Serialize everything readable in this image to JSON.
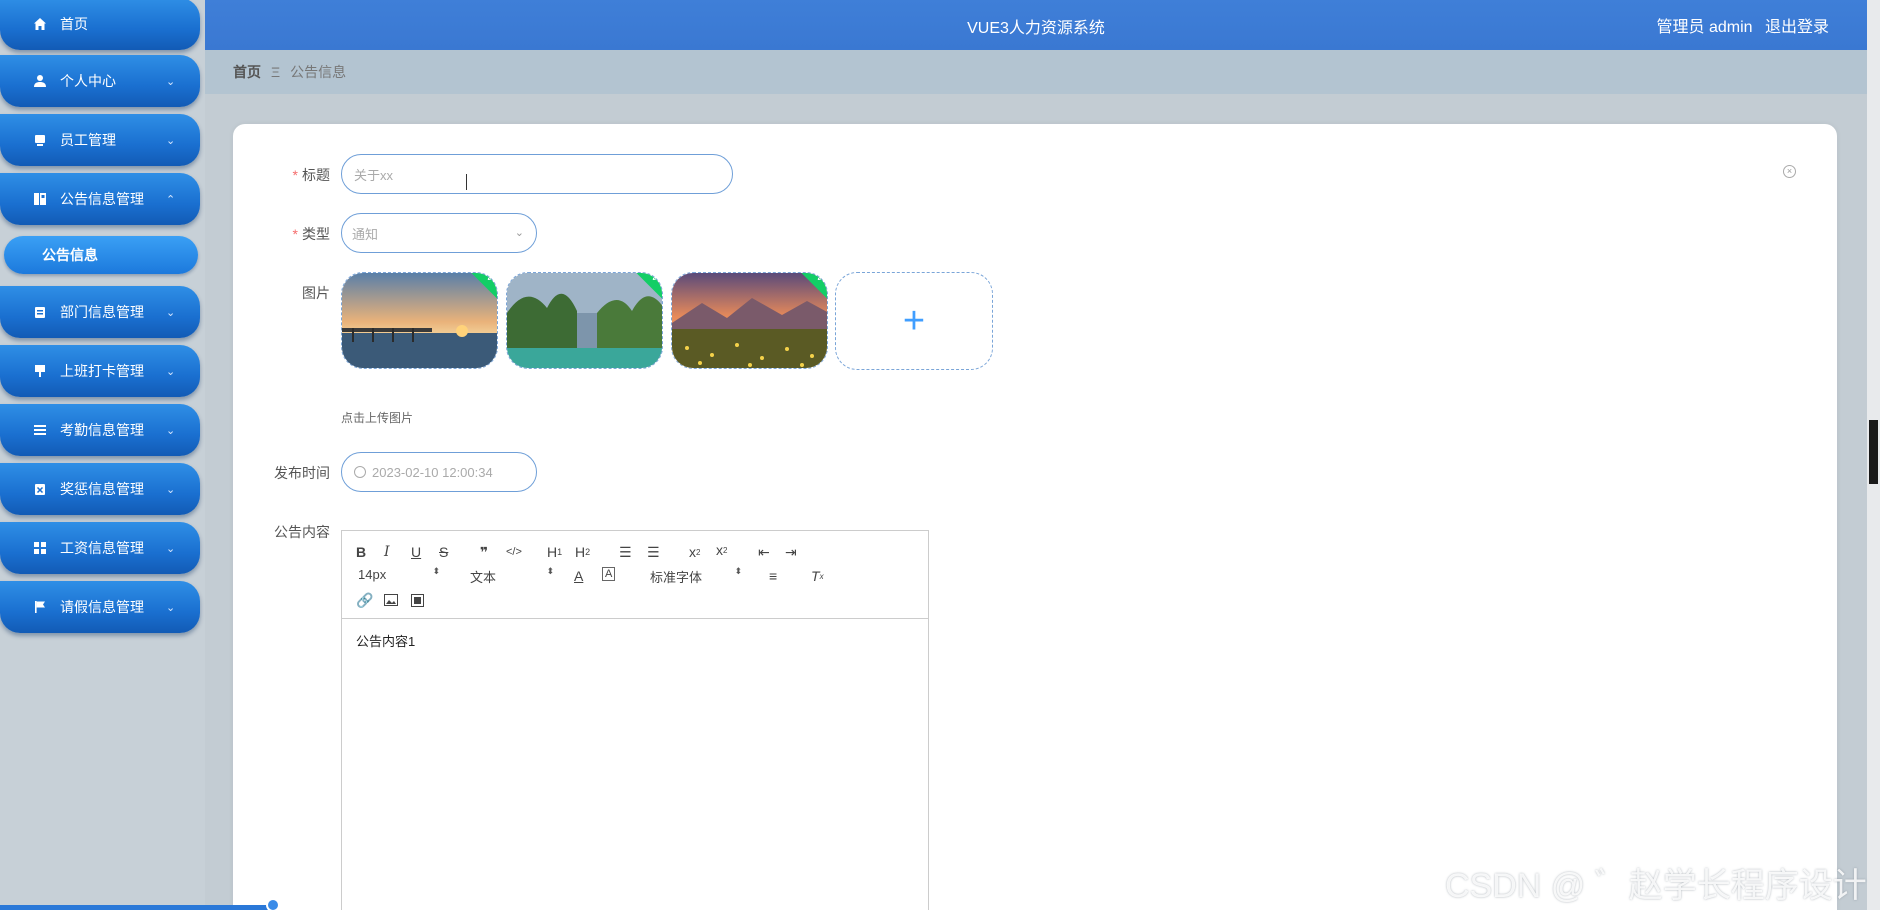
{
  "header": {
    "title": "VUE3人力资源系统",
    "user_label": "管理员 admin",
    "logout_label": "退出登录"
  },
  "breadcrumb": {
    "home": "首页",
    "separator": "Ξ",
    "current": "公告信息"
  },
  "sidebar": {
    "items": [
      {
        "label": "首页",
        "icon": "home-icon"
      },
      {
        "label": "个人中心",
        "icon": "user-icon",
        "expand": "down"
      },
      {
        "label": "员工管理",
        "icon": "monitor-icon",
        "expand": "down"
      },
      {
        "label": "公告信息管理",
        "icon": "book-icon",
        "expand": "up"
      },
      {
        "label": "部门信息管理",
        "icon": "clipboard-icon",
        "expand": "down"
      },
      {
        "label": "上班打卡管理",
        "icon": "stamp-icon",
        "expand": "down"
      },
      {
        "label": "考勤信息管理",
        "icon": "list-icon",
        "expand": "down"
      },
      {
        "label": "奖惩信息管理",
        "icon": "badge-icon",
        "expand": "down"
      },
      {
        "label": "工资信息管理",
        "icon": "grid-icon",
        "expand": "down"
      },
      {
        "label": "请假信息管理",
        "icon": "flag-icon",
        "expand": "down"
      }
    ],
    "active_sub": "公告信息"
  },
  "form": {
    "title_label": "标题",
    "title_placeholder": "关于xx",
    "type_label": "类型",
    "type_value": "通知",
    "image_label": "图片",
    "upload_hint": "点击上传图片",
    "publish_time_label": "发布时间",
    "publish_time_value": "2023-02-10 12:00:34",
    "content_label": "公告内容",
    "required_mark": "*"
  },
  "editor": {
    "font_size": "14px",
    "paragraph": "文本",
    "font_family": "标准字体",
    "content": "公告内容1"
  },
  "watermark": "CSDN @ ゛赵学长程序设计",
  "colors": {
    "header": "#3f7fd8",
    "menu": "#1a6fd0",
    "required": "#f56c6c",
    "success": "#13ce66"
  }
}
